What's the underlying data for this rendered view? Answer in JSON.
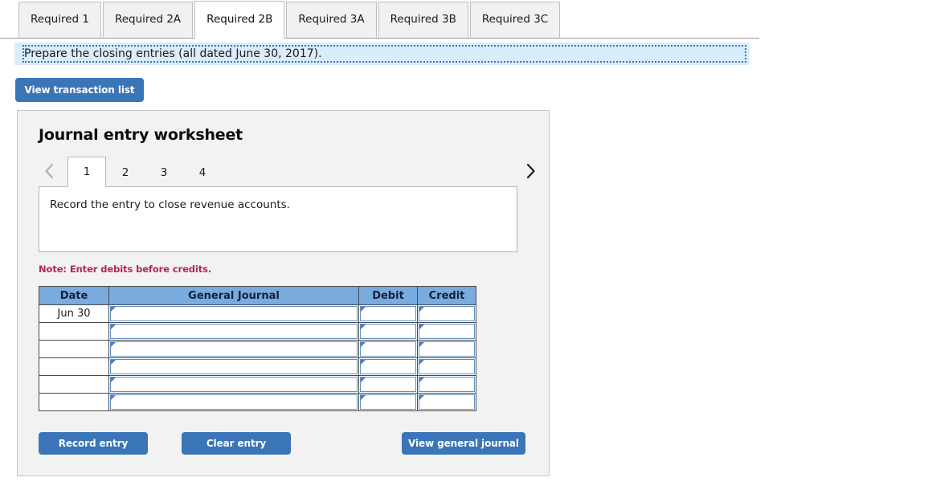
{
  "tabs": [
    {
      "label": "Required 1",
      "active": false
    },
    {
      "label": "Required 2A",
      "active": false
    },
    {
      "label": "Required 2B",
      "active": true
    },
    {
      "label": "Required 3A",
      "active": false
    },
    {
      "label": "Required 3B",
      "active": false
    },
    {
      "label": "Required 3C",
      "active": false
    }
  ],
  "banner": {
    "text": "Prepare the closing entries (all dated June 30, 2017)."
  },
  "toolbar": {
    "view_transaction_list_label": "View transaction list"
  },
  "panel": {
    "title": "Journal entry worksheet",
    "pager": {
      "prev_icon": "chevron-left-icon",
      "next_icon": "chevron-right-icon",
      "prev_enabled": false,
      "next_enabled": true,
      "pages": [
        "1",
        "2",
        "3",
        "4"
      ],
      "active_page": "1"
    },
    "description": "Record the entry to close revenue accounts.",
    "note": "Note: Enter debits before credits.",
    "journal": {
      "columns": [
        "Date",
        "General Journal",
        "Debit",
        "Credit"
      ],
      "rows": [
        {
          "date": "Jun 30",
          "general_journal": "",
          "debit": "",
          "credit": ""
        },
        {
          "date": "",
          "general_journal": "",
          "debit": "",
          "credit": ""
        },
        {
          "date": "",
          "general_journal": "",
          "debit": "",
          "credit": ""
        },
        {
          "date": "",
          "general_journal": "",
          "debit": "",
          "credit": ""
        },
        {
          "date": "",
          "general_journal": "",
          "debit": "",
          "credit": ""
        },
        {
          "date": "",
          "general_journal": "",
          "debit": "",
          "credit": ""
        }
      ]
    },
    "actions": {
      "record_entry_label": "Record entry",
      "clear_entry_label": "Clear entry",
      "view_general_journal_label": "View general journal"
    }
  },
  "colors": {
    "accent_blue": "#3a75b8",
    "header_blue": "#7aabdf",
    "banner_bg": "#d9ecfb",
    "banner_border": "#3c74b4",
    "note_red": "#b5274b",
    "panel_bg": "#f2f2f2"
  }
}
